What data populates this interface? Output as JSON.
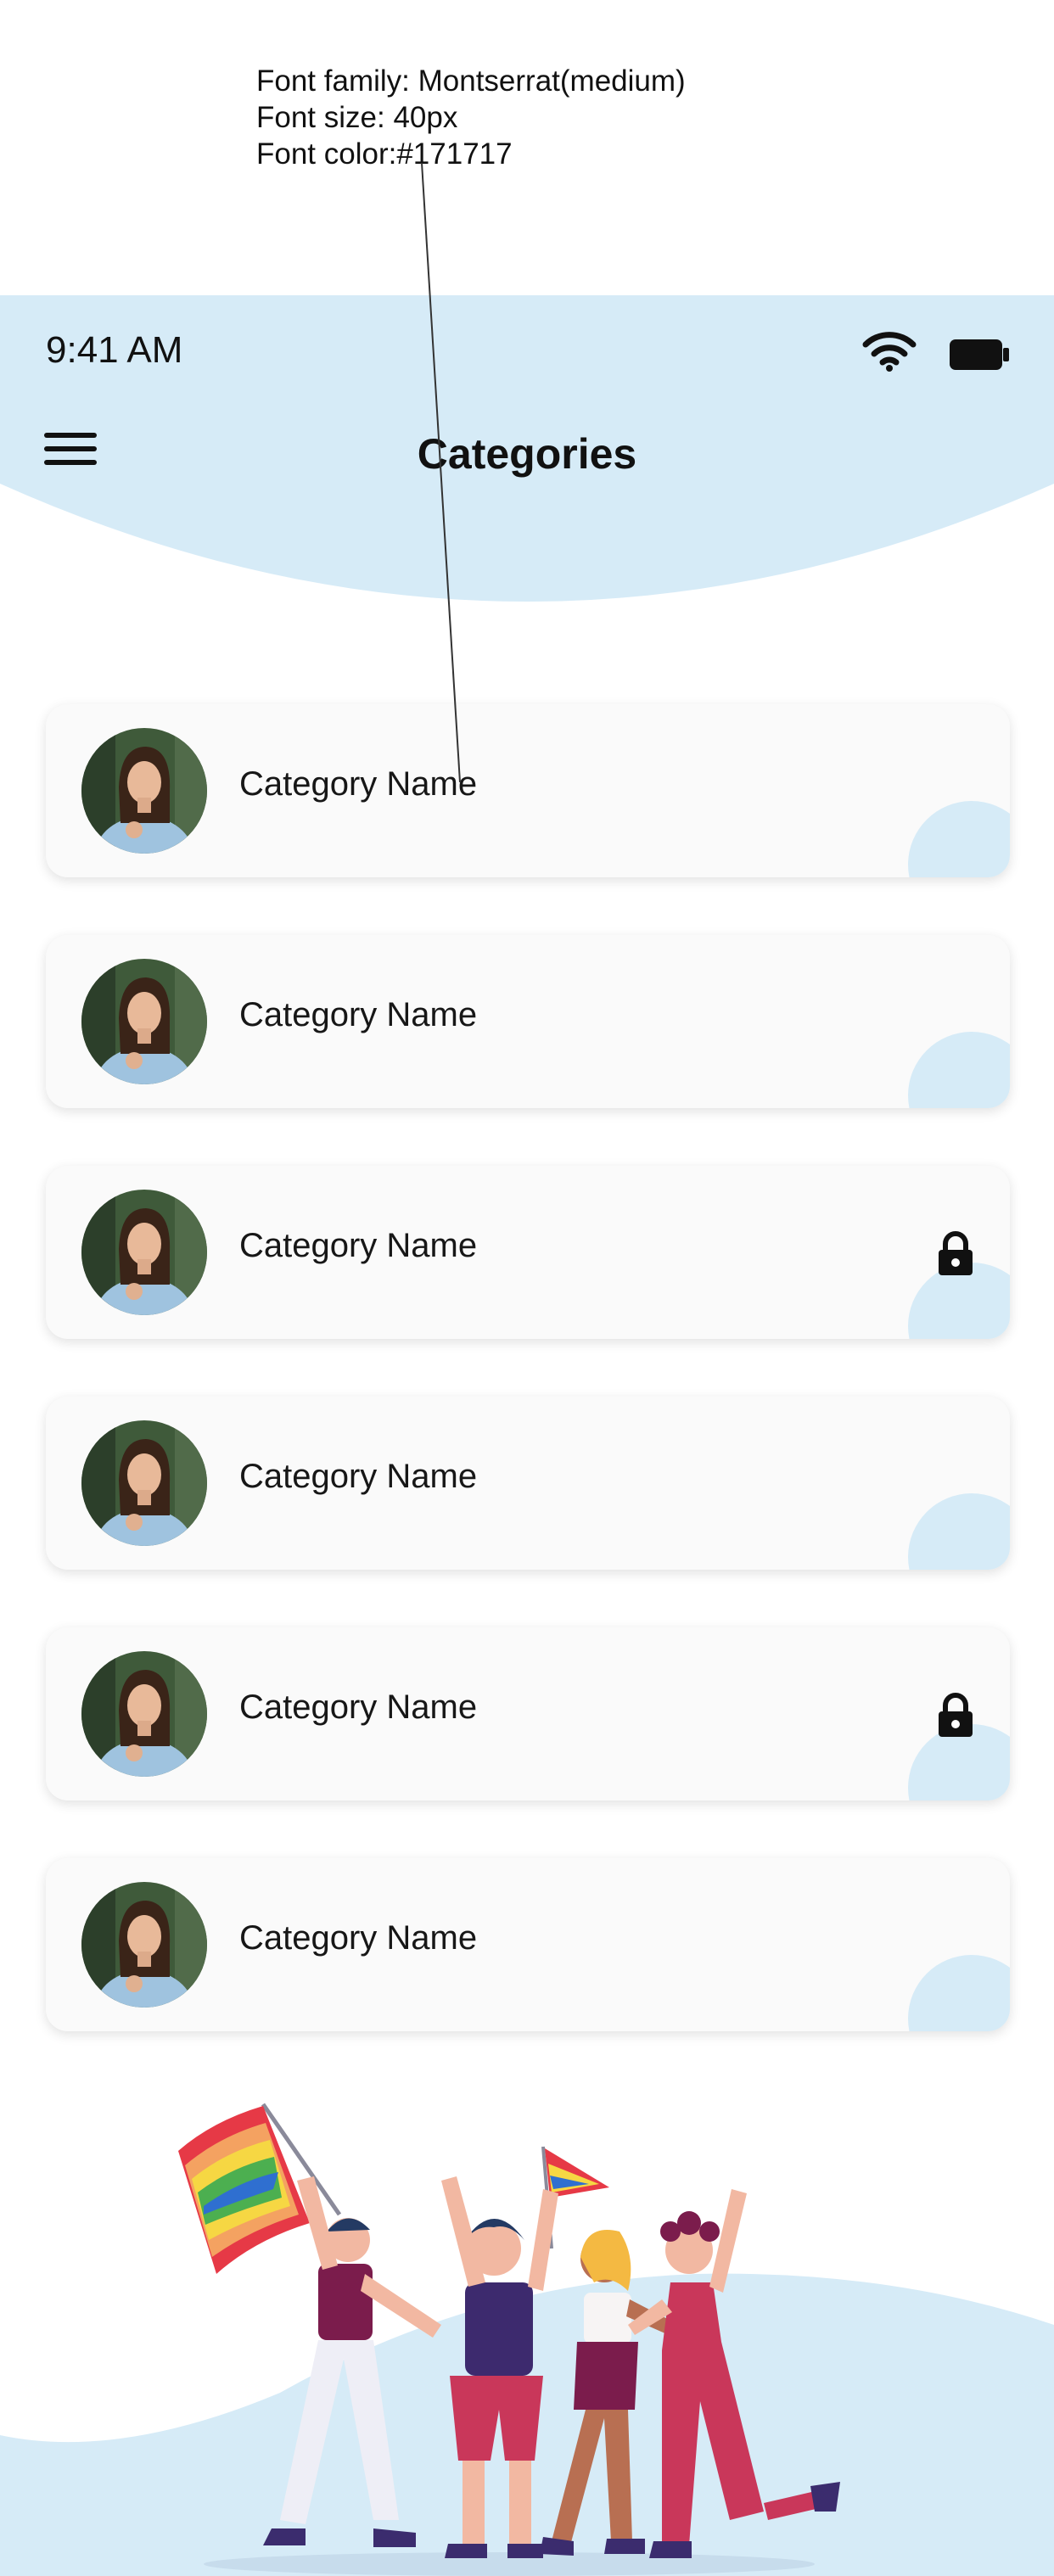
{
  "annotation": {
    "lines": [
      "Font family: Montserrat(medium)",
      "Font size: 40px",
      "Font color:#171717"
    ]
  },
  "status_bar": {
    "time": "9:41 AM"
  },
  "header": {
    "title": "Categories"
  },
  "categories": [
    {
      "label": "Category Name",
      "locked": false
    },
    {
      "label": "Category Name",
      "locked": false
    },
    {
      "label": "Category Name",
      "locked": true
    },
    {
      "label": "Category Name",
      "locked": false
    },
    {
      "label": "Category Name",
      "locked": true
    },
    {
      "label": "Category Name",
      "locked": false
    }
  ],
  "colors": {
    "header_bg": "#d6ebf7",
    "card_bg": "#fafafa",
    "text": "#171717",
    "accent_blob": "#d6ebf7"
  },
  "icons": [
    "wifi-icon",
    "battery-icon",
    "menu-icon",
    "lock-icon"
  ]
}
